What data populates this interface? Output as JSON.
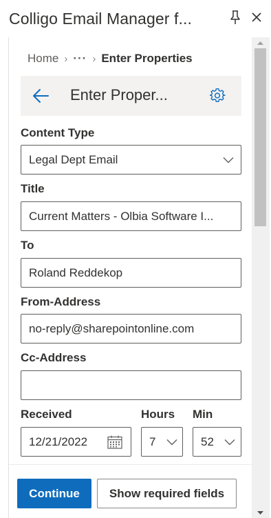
{
  "pane": {
    "title": "Colligo Email Manager f...",
    "pin_icon": "pin-icon",
    "close_icon": "close-icon"
  },
  "breadcrumb": {
    "home": "Home",
    "more": "···",
    "current": "Enter Properties"
  },
  "header": {
    "title": "Enter Proper...",
    "back_icon": "arrow-left-icon",
    "settings_icon": "gear-icon",
    "accent_color": "#0f6cbd"
  },
  "form": {
    "content_type": {
      "label": "Content Type",
      "value": "Legal Dept Email"
    },
    "title": {
      "label": "Title",
      "value": "Current Matters - Olbia Software I..."
    },
    "to": {
      "label": "To",
      "value": "Roland Reddekop"
    },
    "from_address": {
      "label": "From-Address",
      "value": "no-reply@sharepointonline.com"
    },
    "cc_address": {
      "label": "Cc-Address",
      "value": ""
    },
    "received": {
      "label": "Received",
      "value": "12/21/2022",
      "calendar_icon": "calendar-icon"
    },
    "hours": {
      "label": "Hours",
      "value": "7"
    },
    "minutes": {
      "label": "Min",
      "value": "52"
    }
  },
  "footer": {
    "continue_label": "Continue",
    "show_required_label": "Show required fields"
  }
}
